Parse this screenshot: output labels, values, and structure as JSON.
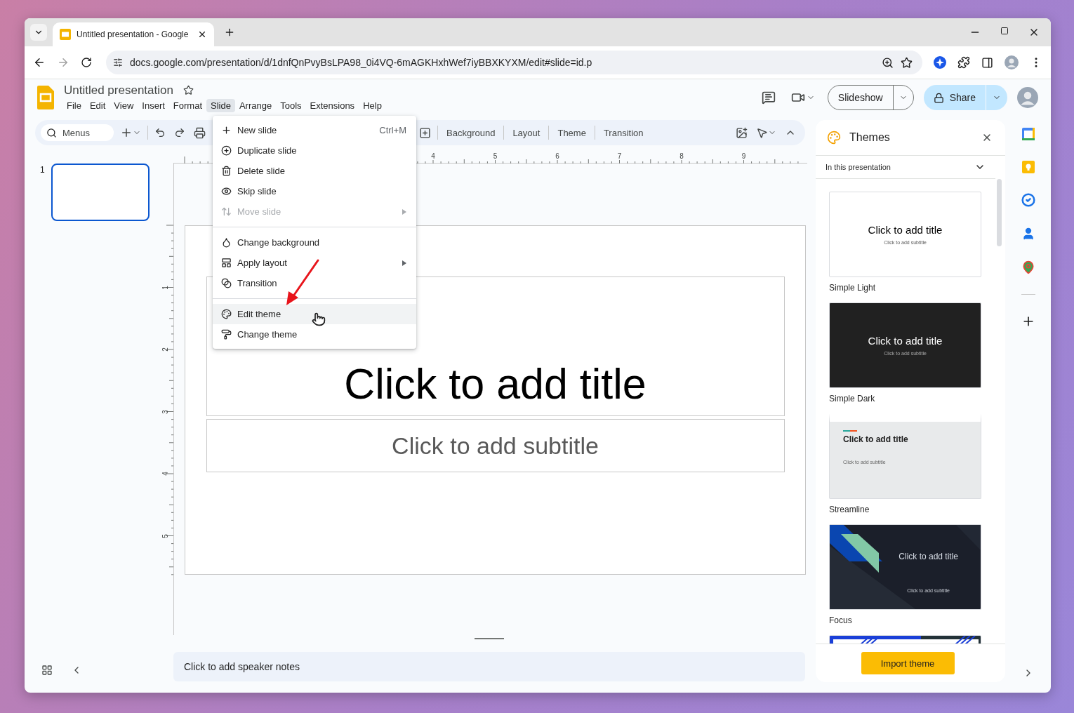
{
  "browser": {
    "tab_title": "Untitled presentation - Google",
    "url": "docs.google.com/presentation/d/1dnfQnPvyBsLPA98_0i4VQ-6mAGKHxhWef7iyBBXKYXM/edit#slide=id.p"
  },
  "doc": {
    "title": "Untitled presentation"
  },
  "menu_bar": [
    {
      "label": "File",
      "selected": false
    },
    {
      "label": "Edit",
      "selected": false
    },
    {
      "label": "View",
      "selected": false
    },
    {
      "label": "Insert",
      "selected": false
    },
    {
      "label": "Format",
      "selected": false
    },
    {
      "label": "Slide",
      "selected": true
    },
    {
      "label": "Arrange",
      "selected": false
    },
    {
      "label": "Tools",
      "selected": false
    },
    {
      "label": "Extensions",
      "selected": false
    },
    {
      "label": "Help",
      "selected": false
    }
  ],
  "header": {
    "slideshow": "Slideshow",
    "share": "Share"
  },
  "toolbar": {
    "search": "Menus",
    "buttons": [
      "Background",
      "Layout",
      "Theme",
      "Transition"
    ]
  },
  "slide_menu": {
    "groups": [
      {
        "items": [
          {
            "kind": "plus",
            "label": "New slide",
            "shortcut": "Ctrl+M",
            "submenu": false,
            "disabled": false,
            "highlighted": false
          },
          {
            "kind": "duplicate",
            "label": "Duplicate slide",
            "submenu": false,
            "disabled": false,
            "highlighted": false
          },
          {
            "kind": "trash",
            "label": "Delete slide",
            "submenu": false,
            "disabled": false,
            "highlighted": false
          },
          {
            "kind": "eye",
            "label": "Skip slide",
            "submenu": false,
            "disabled": false,
            "highlighted": false
          },
          {
            "kind": "move",
            "label": "Move slide",
            "submenu": true,
            "disabled": true,
            "highlighted": false
          }
        ]
      },
      {
        "items": [
          {
            "kind": "background",
            "label": "Change background",
            "submenu": false,
            "disabled": false,
            "highlighted": false
          },
          {
            "kind": "layout",
            "label": "Apply layout",
            "submenu": true,
            "disabled": false,
            "highlighted": false
          },
          {
            "kind": "transition",
            "label": "Transition",
            "submenu": false,
            "disabled": false,
            "highlighted": false
          }
        ]
      },
      {
        "items": [
          {
            "kind": "palette",
            "label": "Edit theme",
            "submenu": false,
            "disabled": false,
            "highlighted": true
          },
          {
            "kind": "roller",
            "label": "Change theme",
            "submenu": false,
            "disabled": false,
            "highlighted": false
          }
        ]
      }
    ]
  },
  "filmstrip": {
    "slides": [
      {
        "number": "1",
        "selected": true
      }
    ]
  },
  "ruler": {
    "top_labels": [
      "4",
      "5",
      "6",
      "7",
      "8",
      "9"
    ],
    "side_labels": [
      "1",
      "2",
      "3",
      "4",
      "5"
    ]
  },
  "slide": {
    "title": "Click to add title",
    "subtitle": "Click to add subtitle"
  },
  "speaker_notes": {
    "placeholder": "Click to add speaker notes"
  },
  "themes_panel": {
    "title": "Themes",
    "filter": "In this presentation",
    "import_button": "Import theme",
    "themes": [
      {
        "kind": "simple_light",
        "name": "Simple Light",
        "title": "Click to add title",
        "subtitle": "Click to add subtitle"
      },
      {
        "kind": "simple_dark",
        "name": "Simple Dark",
        "title": "Click to add title",
        "subtitle": "Click to add subtitle"
      },
      {
        "kind": "streamline",
        "name": "Streamline",
        "title": "Click to add title",
        "subtitle": "Click to add subtitle"
      },
      {
        "kind": "focus",
        "name": "Focus",
        "title": "Click to add title",
        "subtitle": "Click to add subtitle"
      },
      {
        "kind": "stripes"
      }
    ]
  }
}
